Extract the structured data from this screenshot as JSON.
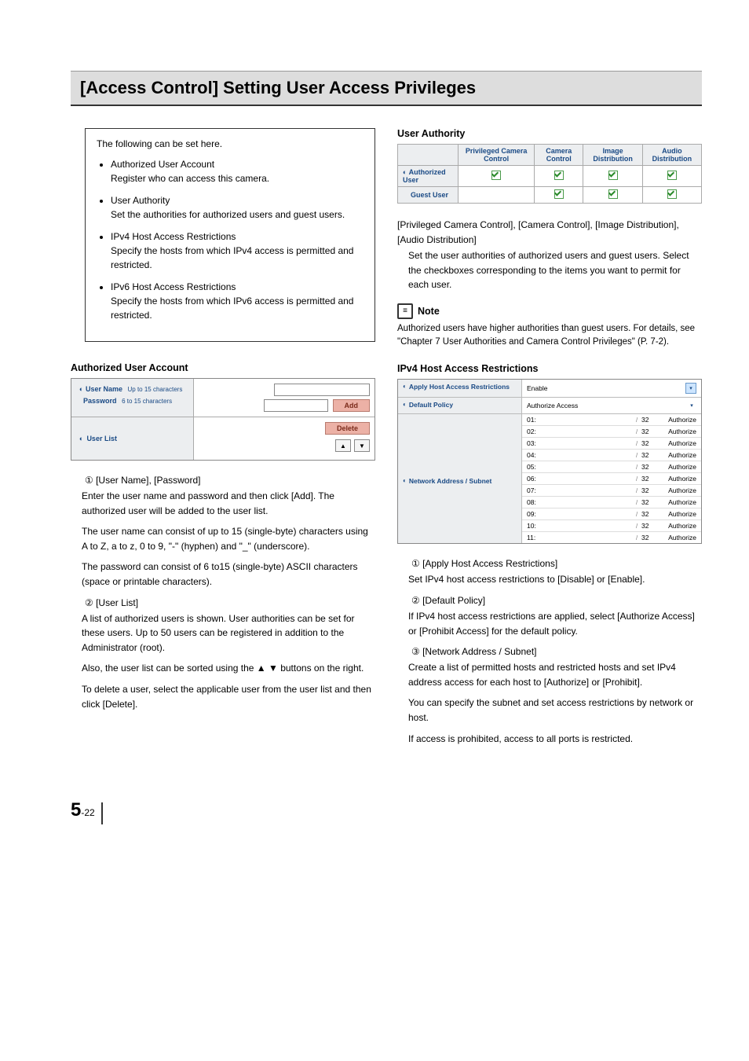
{
  "title": "[Access Control] Setting User Access Privileges",
  "intro": {
    "lead": "The following can be set here.",
    "items": [
      {
        "head": "Authorized User Account",
        "body": "Register who can access this camera."
      },
      {
        "head": "User Authority",
        "body": "Set the authorities for authorized users and guest users."
      },
      {
        "head": "IPv4 Host Access Restrictions",
        "body": "Specify the hosts from which IPv4 access is permitted and restricted."
      },
      {
        "head": "IPv6 Host Access Restrictions",
        "body": "Specify the hosts from which IPv6 access is permitted and restricted."
      }
    ]
  },
  "left": {
    "heading": "Authorized User Account",
    "form": {
      "user_label": "User Name",
      "user_hint": "Up to 15 characters",
      "pass_label": "Password",
      "pass_hint": "6 to 15 characters",
      "add_btn": "Add",
      "list_label": "User List",
      "delete_btn": "Delete"
    },
    "item1_head": "① [User Name], [Password]",
    "item1_body1": "Enter the user name and password and then click [Add]. The authorized user will be added to the user list.",
    "item1_body2": "The user name can consist of up to 15 (single-byte) characters using A to Z, a to z, 0 to 9, \"-\" (hyphen) and \"_\" (underscore).",
    "item1_body3": "The password can consist of 6 to15 (single-byte) ASCII characters (space or printable characters).",
    "item2_head": "② [User List]",
    "item2_body1": "A list of authorized users is shown. User authorities can be set for these users. Up to 50 users can be registered in addition to the Administrator (root).",
    "item2_body2": "Also, the user list can be sorted using the ▲ ▼ buttons on the right.",
    "item2_body3": "To delete a user, select the applicable user from the user list and then click [Delete]."
  },
  "right": {
    "ua_heading": "User Authority",
    "ua_table": {
      "cols": [
        "Privileged Camera Control",
        "Camera Control",
        "Image Distribution",
        "Audio Distribution"
      ],
      "rows": [
        {
          "name": "Authorized User",
          "checks": [
            true,
            true,
            true,
            true
          ],
          "icon": true
        },
        {
          "name": "Guest User",
          "checks": [
            false,
            true,
            true,
            true
          ],
          "icon": false
        }
      ]
    },
    "ua_sub": "[Privileged Camera Control], [Camera Control], [Image Distribution], [Audio Distribution]",
    "ua_body": "Set the user authorities of authorized users and guest users. Select the checkboxes corresponding to the items you want to permit for each user.",
    "note_label": "Note",
    "note_body": "Authorized users have higher authorities than guest users. For details, see \"Chapter 7 User Authorities and Camera Control Privileges\" (P. 7-2).",
    "ipv4_heading": "IPv4 Host Access Restrictions",
    "ipv4_fig": {
      "apply_label": "Apply Host Access Restrictions",
      "apply_value": "Enable",
      "policy_label": "Default Policy",
      "policy_value": "Authorize Access",
      "netaddr_label": "Network Address / Subnet",
      "rows": [
        {
          "n": "01:",
          "m": "32",
          "a": "Authorize"
        },
        {
          "n": "02:",
          "m": "32",
          "a": "Authorize"
        },
        {
          "n": "03:",
          "m": "32",
          "a": "Authorize"
        },
        {
          "n": "04:",
          "m": "32",
          "a": "Authorize"
        },
        {
          "n": "05:",
          "m": "32",
          "a": "Authorize"
        },
        {
          "n": "06:",
          "m": "32",
          "a": "Authorize"
        },
        {
          "n": "07:",
          "m": "32",
          "a": "Authorize"
        },
        {
          "n": "08:",
          "m": "32",
          "a": "Authorize"
        },
        {
          "n": "09:",
          "m": "32",
          "a": "Authorize"
        },
        {
          "n": "10:",
          "m": "32",
          "a": "Authorize"
        },
        {
          "n": "11:",
          "m": "32",
          "a": "Authorize"
        }
      ]
    },
    "ipv4_item1_head": "① [Apply Host Access Restrictions]",
    "ipv4_item1_body": "Set IPv4 host access restrictions to [Disable] or [Enable].",
    "ipv4_item2_head": "② [Default Policy]",
    "ipv4_item2_body": "If IPv4 host access restrictions are applied, select [Authorize Access] or [Prohibit Access] for the default policy.",
    "ipv4_item3_head": "③ [Network Address / Subnet]",
    "ipv4_item3_body1": "Create a list of permitted hosts and restricted hosts and set IPv4 address access for each host to [Authorize] or [Prohibit].",
    "ipv4_item3_body2": "You can specify the subnet and set access restrictions by network or host.",
    "ipv4_item3_body3": "If access is prohibited, access to all ports is restricted."
  },
  "page": {
    "chapter": "5",
    "sep": "-",
    "num": "22"
  }
}
